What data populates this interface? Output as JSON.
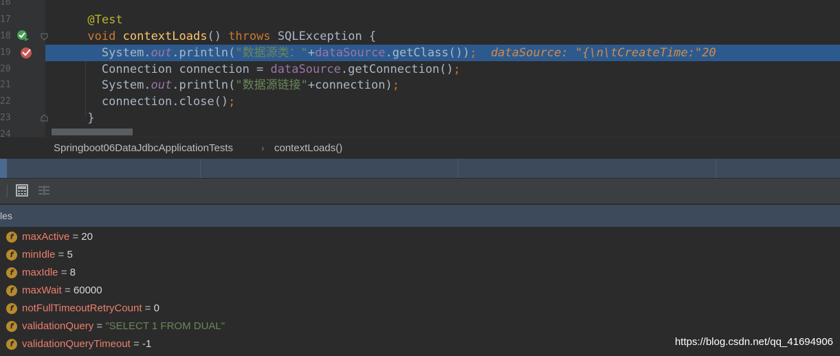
{
  "editor": {
    "line_numbers": [
      "16",
      "17",
      "18",
      "19",
      "20",
      "21",
      "22",
      "23",
      "24"
    ],
    "lines": {
      "l17": {
        "annotation": "@Test"
      },
      "l18": {
        "void_kw": "void",
        "method": "contextLoads",
        "parens": "()",
        "throws_kw": "throws",
        "exception": "SQLException {"
      },
      "l19": {
        "system": "System.",
        "out": "out",
        "println": ".println(",
        "str": "\"数据源类：\"",
        "plus": "+",
        "ds": "dataSource",
        "getclass": ".getClass())",
        "semi": ";",
        "dbg_label": "dataSource:",
        "dbg_value": "\"{\\n\\tCreateTime:\"20"
      },
      "l20": {
        "type": "Connection connection = ",
        "ds": "dataSource",
        "call": ".getConnection()",
        "semi": ";"
      },
      "l21": {
        "system": "System.",
        "out": "out",
        "println": ".println(",
        "str": "\"数据源链接\"",
        "rest": "+connection)",
        "semi": ";"
      },
      "l22": {
        "close": "connection.close()",
        "semi": ";"
      },
      "l23": {
        "brace": "}"
      }
    }
  },
  "breadcrumb": {
    "class_name": "Springboot06DataJdbcApplicationTests",
    "separator": "›",
    "method_name": "contextLoads()"
  },
  "variables_panel": {
    "title": "les",
    "icon_letter": "f",
    "items": [
      {
        "name": "maxActive",
        "eq": " = ",
        "value": "20",
        "kind": "num"
      },
      {
        "name": "minIdle",
        "eq": " = ",
        "value": "5",
        "kind": "num"
      },
      {
        "name": "maxIdle",
        "eq": " = ",
        "value": "8",
        "kind": "num"
      },
      {
        "name": "maxWait",
        "eq": " = ",
        "value": "60000",
        "kind": "num"
      },
      {
        "name": "notFullTimeoutRetryCount",
        "eq": " = ",
        "value": "0",
        "kind": "num"
      },
      {
        "name": "validationQuery",
        "eq": " = ",
        "value": "\"SELECT 1 FROM DUAL\"",
        "kind": "str"
      },
      {
        "name": "validationQueryTimeout",
        "eq": " = ",
        "value": "-1",
        "kind": "num"
      }
    ]
  },
  "watermark": "https://blog.csdn.net/qq_41694906",
  "colors": {
    "editor_bg": "#2b2b2b",
    "selection": "#2d5a8e",
    "keyword": "#cc7832",
    "string": "#6a8759",
    "field": "#9876aa",
    "var_name": "#ec7f6c"
  }
}
